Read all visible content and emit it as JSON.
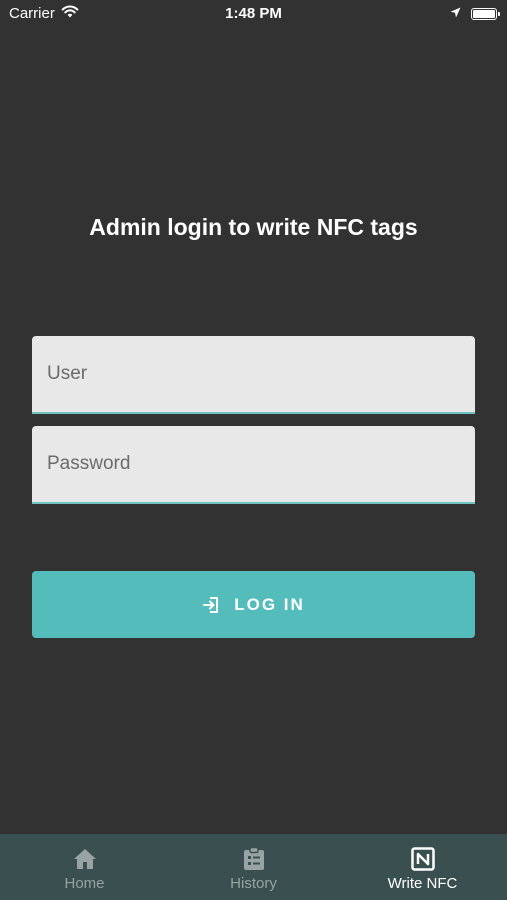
{
  "status_bar": {
    "carrier": "Carrier",
    "time": "1:48 PM",
    "icons": [
      "wifi-icon",
      "location-arrow-icon",
      "battery-icon"
    ]
  },
  "page": {
    "title": "Admin login to write NFC tags"
  },
  "form": {
    "user_placeholder": "User",
    "password_placeholder": "Password",
    "login_label": "LOG IN",
    "login_icon": "login-icon"
  },
  "tab_bar": {
    "active": "Write NFC",
    "items": [
      {
        "label": "Home",
        "icon": "home-icon"
      },
      {
        "label": "History",
        "icon": "clipboard-icon"
      },
      {
        "label": "Write NFC",
        "icon": "nfc-icon"
      }
    ]
  },
  "colors": {
    "background": "#323232",
    "accent": "#55bcbc",
    "input_bg": "#e8e8e8",
    "tab_bar_bg": "#3a4f4f",
    "tab_inactive": "#98a3a3",
    "tab_active": "#ffffff"
  }
}
